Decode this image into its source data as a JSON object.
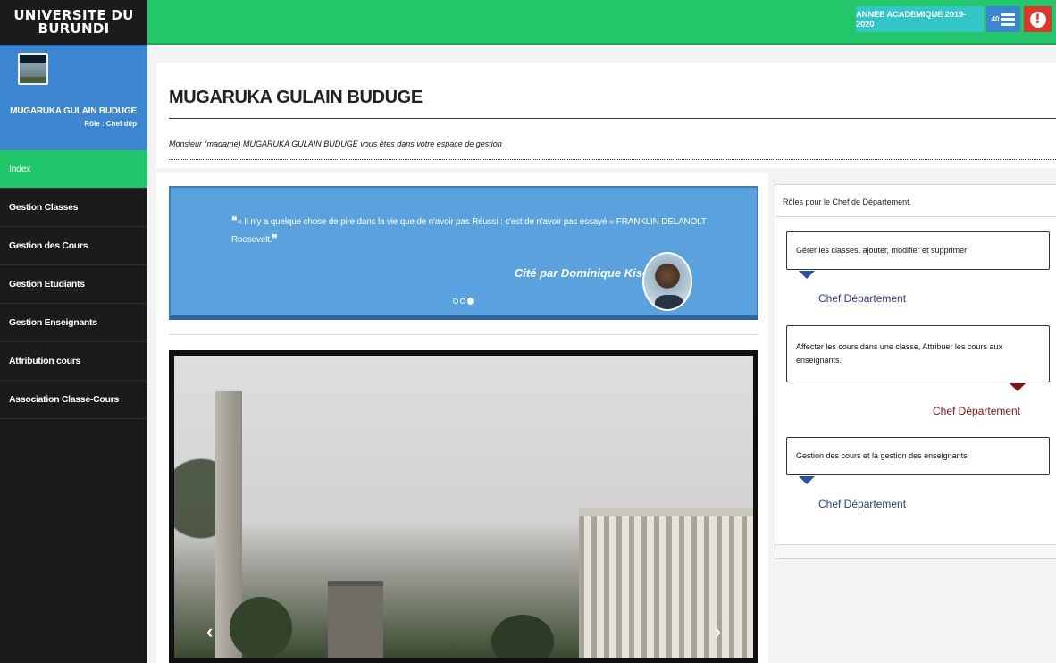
{
  "brand": {
    "line1": "UNIVERSITE DU",
    "line2": "BURUNDI"
  },
  "profile": {
    "name": "MUGARUKA GULAIN BUDUGE",
    "role": "Rôle : Chef dép"
  },
  "nav": {
    "items": [
      {
        "label": "Index",
        "active": true
      },
      {
        "label": "Gestion Classes"
      },
      {
        "label": "Gestion des Cours"
      },
      {
        "label": "Gestion Etudiants"
      },
      {
        "label": "Gestion Enseignants"
      },
      {
        "label": "Attribution cours"
      },
      {
        "label": "Association Classe-Cours"
      }
    ]
  },
  "topbar": {
    "year_label": "ANNEE ACADEMIQUE 2019-2020",
    "count": "40",
    "colors": {
      "green": "#22c769",
      "teal": "#33c6c9",
      "blue": "#3c85d0",
      "red": "#e0352b"
    }
  },
  "header": {
    "title": "MUGARUKA GULAIN BUDUGE",
    "welcome": "Monsieur (madame) MUGARUKA GULAIN BUDUGE vous êtes dans votre espace de gestion"
  },
  "quote": {
    "open_mark": "❝",
    "text": "« Il n'y a quelque chose de pire dans la vie que de n'avoir pas Réussi : c'est de n'avoir pas essayé » FRANKLIN DELANOLT Roosevelt.",
    "close_mark": "❞",
    "author": "Cité par Dominique Kiseki"
  },
  "carousel": {
    "prev": "‹",
    "next": "›"
  },
  "roles": {
    "heading": "Rôles pour le Chef de Département.",
    "items": [
      {
        "text": "Gérer les classes, ajouter, modifier et supprimer",
        "signature": "Chef Département"
      },
      {
        "text": "Affecter les cours dans une classe, Attribuer les cours aux enseignants.",
        "signature": "Chef Département"
      },
      {
        "text": "Gestion des cours et la gestion des enseignants",
        "signature": "Chef Département"
      }
    ]
  }
}
